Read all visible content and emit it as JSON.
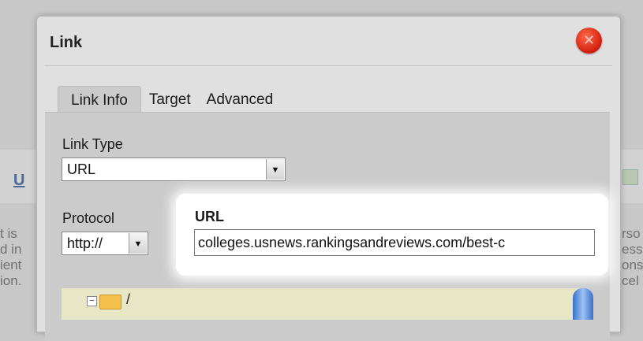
{
  "dialog": {
    "title": "Link",
    "close_glyph": "✕"
  },
  "tabs": [
    {
      "label": "Link Info",
      "active": true
    },
    {
      "label": "Target",
      "active": false
    },
    {
      "label": "Advanced",
      "active": false
    }
  ],
  "link_type": {
    "label": "Link Type",
    "value": "URL"
  },
  "protocol": {
    "label": "Protocol",
    "value": "http://"
  },
  "url": {
    "label": "URL",
    "value": "colleges.usnews.rankingsandreviews.com/best-c"
  },
  "tree": {
    "root_label": "/",
    "expander": "−"
  },
  "background": {
    "u_glyph": "U",
    "left_fragments": [
      "t is",
      "d in",
      "ient",
      "ion."
    ],
    "right_fragments": [
      "rso",
      "ess",
      "ons",
      "cel"
    ]
  },
  "colors": {
    "accent_close": "#d21d0c",
    "tree_bg": "#e7e6c6",
    "folder": "#f3c04c"
  },
  "icons": {
    "close": "close-icon",
    "folder": "folder-icon",
    "dropdown": "chevron-down-icon"
  }
}
